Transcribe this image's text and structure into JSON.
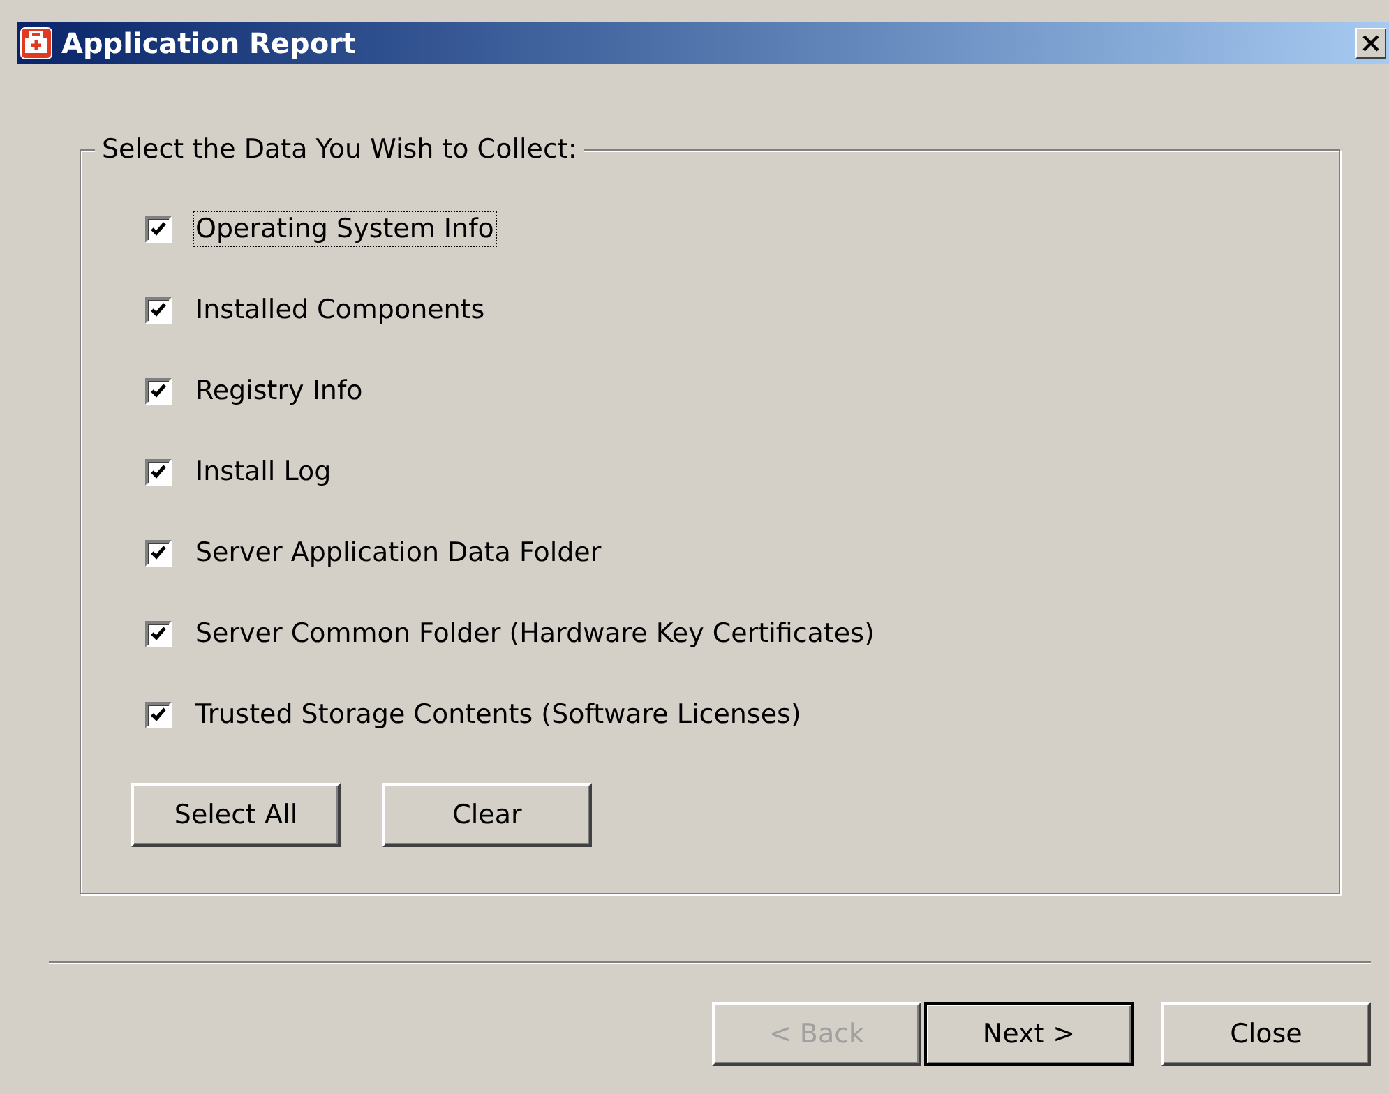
{
  "window": {
    "title": "Application Report"
  },
  "group": {
    "title": "Select the Data You Wish to Collect:",
    "items": [
      {
        "label": "Operating System Info",
        "checked": true,
        "focused": true
      },
      {
        "label": "Installed Components",
        "checked": true,
        "focused": false
      },
      {
        "label": "Registry Info",
        "checked": true,
        "focused": false
      },
      {
        "label": "Install Log",
        "checked": true,
        "focused": false
      },
      {
        "label": "Server Application Data Folder",
        "checked": true,
        "focused": false
      },
      {
        "label": "Server Common Folder (Hardware Key Certificates)",
        "checked": true,
        "focused": false
      },
      {
        "label": "Trusted Storage Contents (Software Licenses)",
        "checked": true,
        "focused": false
      }
    ],
    "buttons": [
      {
        "label": "Select All"
      },
      {
        "label": "Clear"
      }
    ]
  },
  "footer_buttons": [
    {
      "label": "< Back",
      "disabled": true,
      "default": false
    },
    {
      "label": "Next >",
      "disabled": false,
      "default": true
    },
    {
      "label": "Close",
      "disabled": false,
      "default": false
    }
  ]
}
